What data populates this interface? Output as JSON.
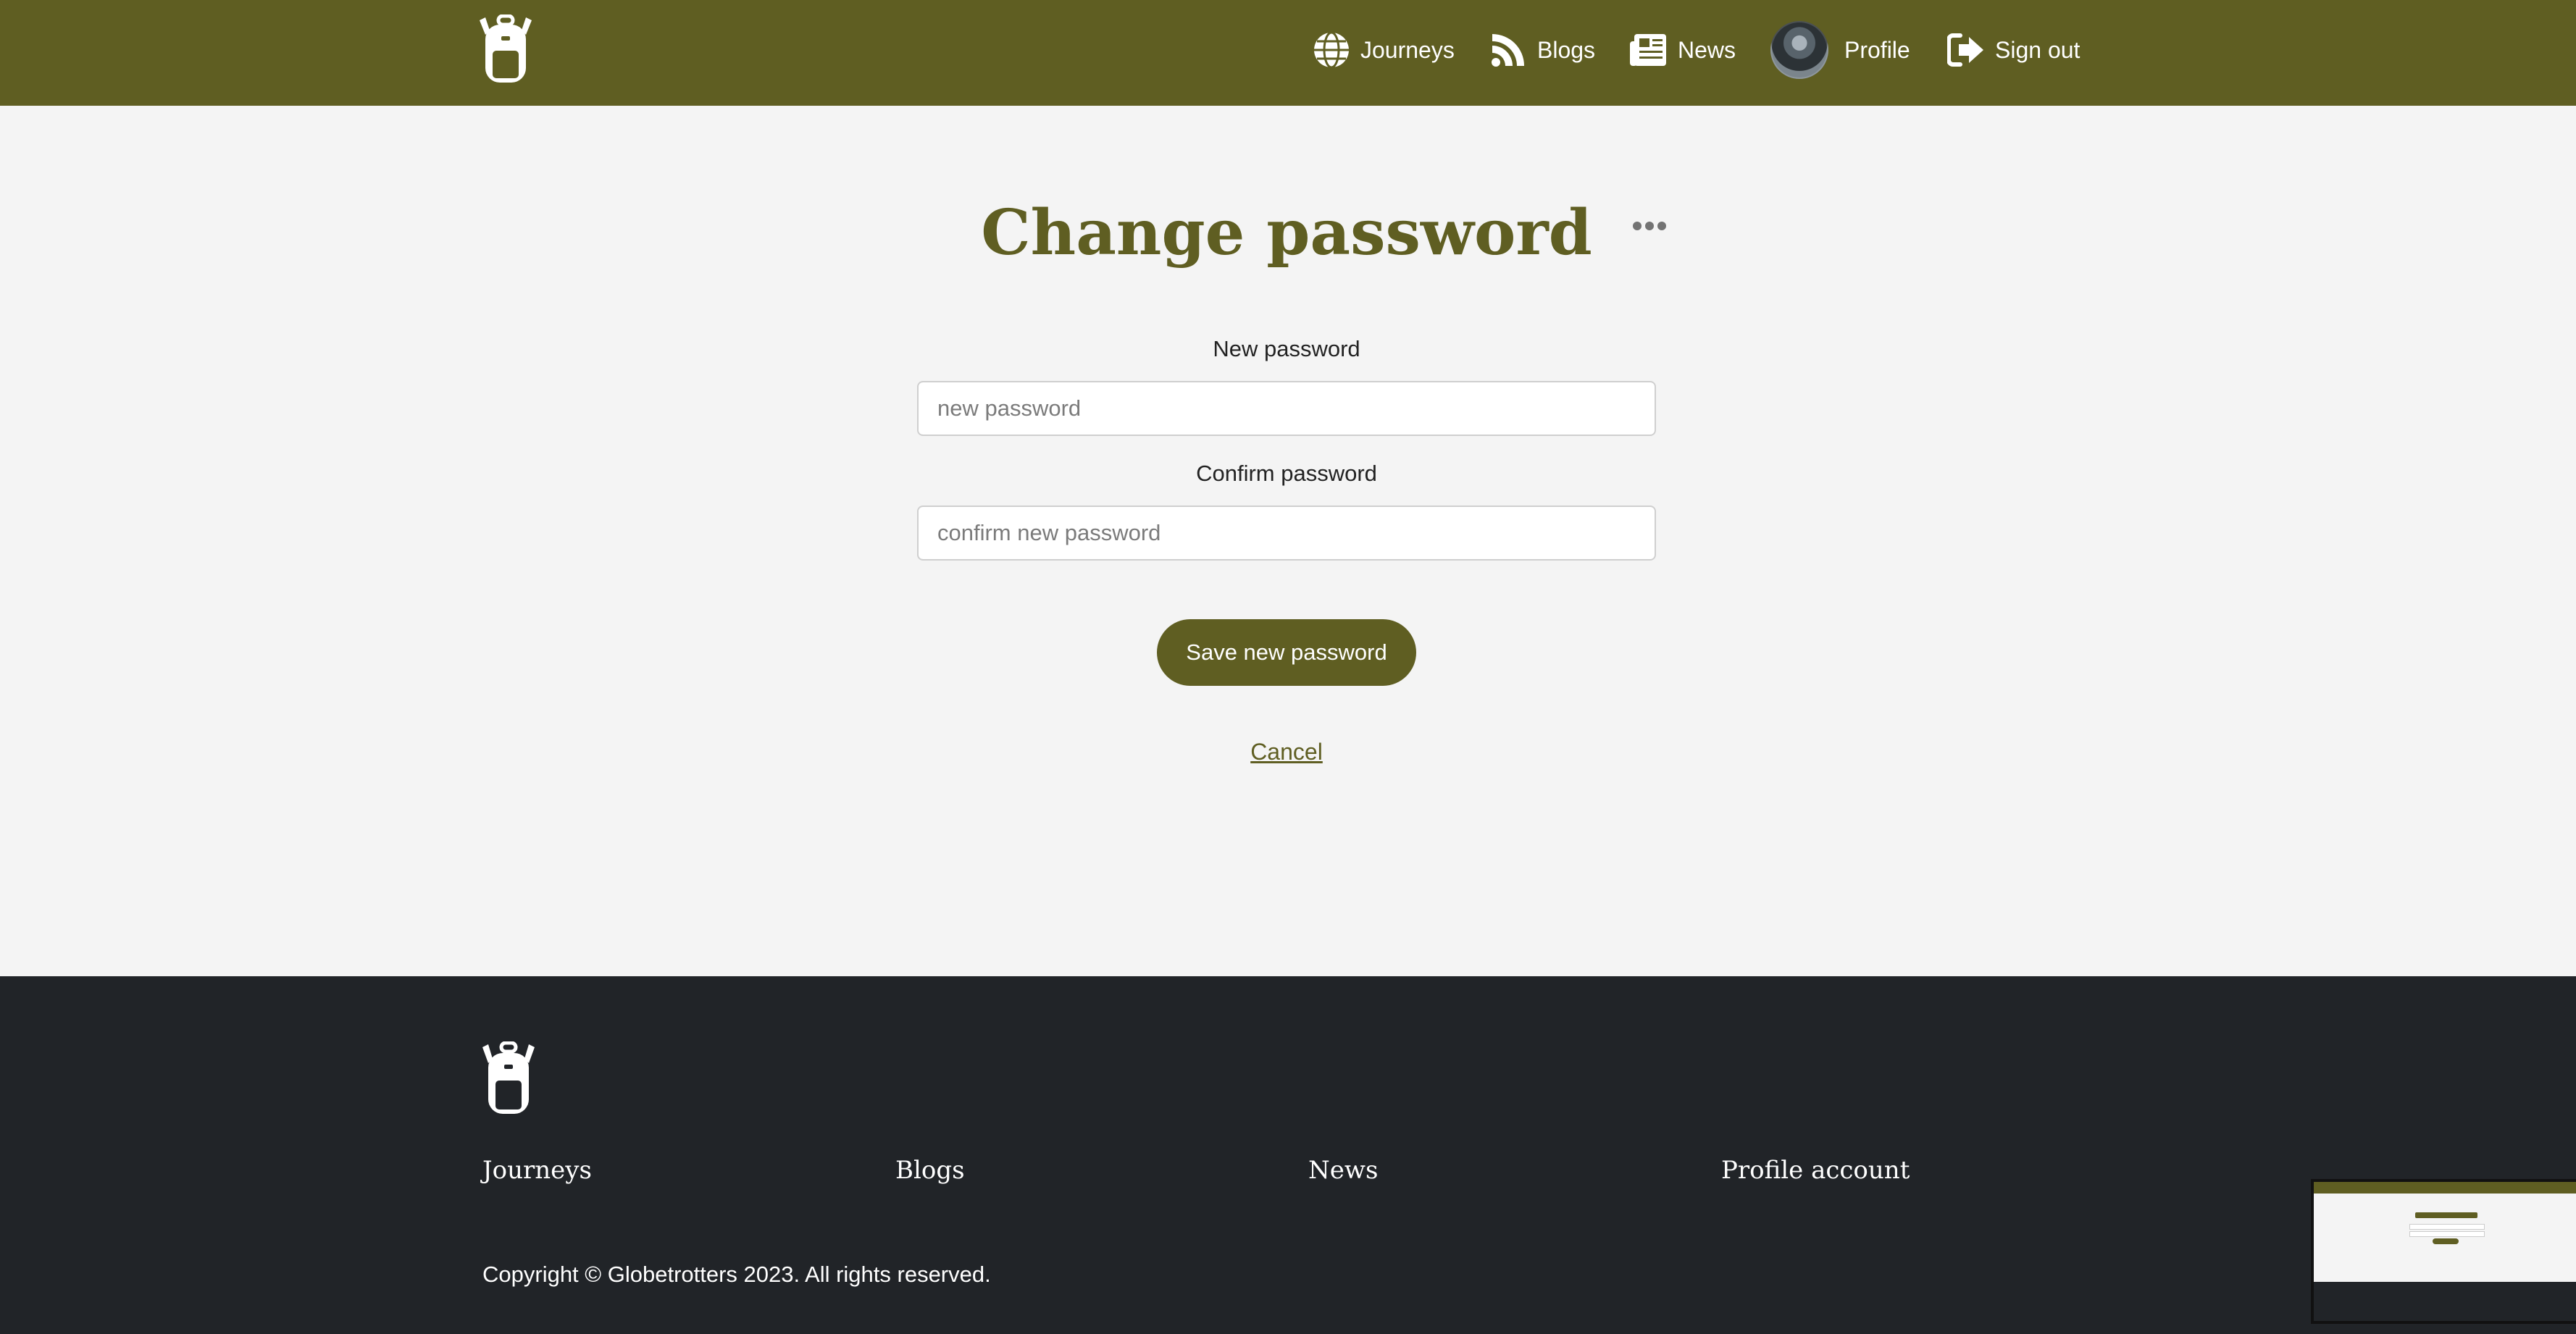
{
  "nav": {
    "logo_icon": "backpack-icon",
    "items": [
      {
        "label": "Journeys",
        "icon": "globe-icon"
      },
      {
        "label": "Blogs",
        "icon": "rss-icon"
      },
      {
        "label": "News",
        "icon": "newspaper-icon"
      },
      {
        "label": "Profile",
        "icon": "avatar"
      },
      {
        "label": "Sign out",
        "icon": "sign-out-icon"
      }
    ]
  },
  "main": {
    "title": "Change password",
    "menu_icon": "ellipsis-icon",
    "new_password": {
      "label": "New password",
      "placeholder": "new password",
      "value": ""
    },
    "confirm_password": {
      "label": "Confirm password",
      "placeholder": "confirm new password",
      "value": ""
    },
    "save_label": "Save new password",
    "cancel_label": "Cancel"
  },
  "footer": {
    "logo_icon": "backpack-icon",
    "links": [
      "Journeys",
      "Blogs",
      "News",
      "Profile account"
    ],
    "copyright": "Copyright © Globetrotters 2023. All rights reserved."
  },
  "colors": {
    "brand": "#5f5e22",
    "page_bg": "#f4f4f4",
    "footer_bg": "#212428"
  }
}
